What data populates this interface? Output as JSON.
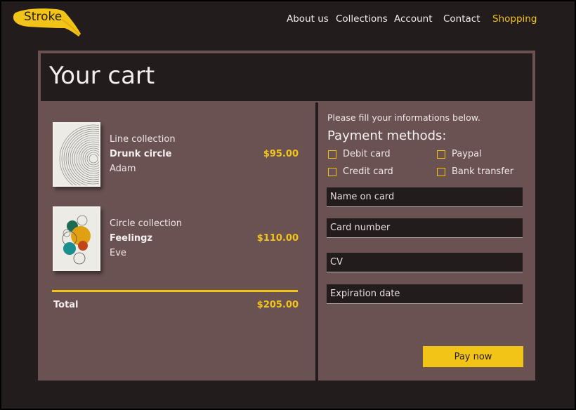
{
  "brand": {
    "logo_text": "Stroke",
    "accent": "#f2c418"
  },
  "nav": {
    "items": [
      {
        "label": "About us"
      },
      {
        "label": "Collections"
      },
      {
        "label": "Account"
      },
      {
        "label": "Contact"
      },
      {
        "label": "Shopping",
        "active": true
      }
    ]
  },
  "cart": {
    "title": "Your cart",
    "items": [
      {
        "collection": "Line collection",
        "name": "Drunk circle",
        "artist": "Adam",
        "price": "$95.00",
        "image": "concentric-lines-artwork"
      },
      {
        "collection": "Circle collection",
        "name": "Feelingz",
        "artist": "Eve",
        "price": "$110.00",
        "image": "colored-circles-artwork"
      }
    ],
    "total_label": "Total",
    "total_value": "$205.00"
  },
  "payment": {
    "hint": "Please fill your informations below.",
    "title": "Payment methods:",
    "methods": [
      "Debit card",
      "Paypal",
      "Credit card",
      "Bank transfer"
    ],
    "fields": {
      "name_placeholder": "Name on card",
      "number_placeholder": "Card number",
      "cv_placeholder": "CV",
      "expiry_placeholder": "Expiration date"
    },
    "pay_label": "Pay now"
  }
}
